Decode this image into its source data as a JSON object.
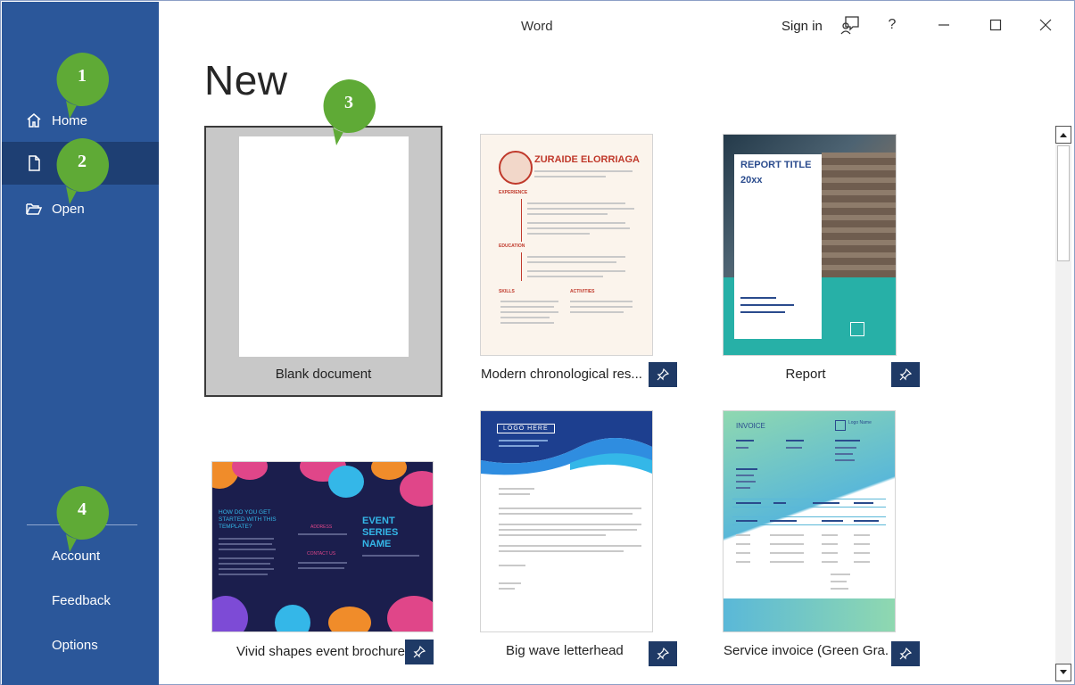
{
  "window": {
    "title": "Word"
  },
  "titlebar": {
    "sign_in": "Sign in",
    "help": "?"
  },
  "sidebar": {
    "items": [
      {
        "label": "Home",
        "icon": "home-icon"
      },
      {
        "label": "",
        "icon": "new-document-icon",
        "active": true
      },
      {
        "label": "Open",
        "icon": "folder-open-icon"
      }
    ],
    "bottom": {
      "account": "Account",
      "feedback": "Feedback",
      "options": "Options"
    }
  },
  "main": {
    "heading": "New",
    "templates": [
      {
        "label": "Blank document",
        "selected": true
      },
      {
        "label": "Modern chronological res...",
        "pinned": true
      },
      {
        "label": "Report",
        "pinned": true
      },
      {
        "label": "Vivid shapes event brochure",
        "pinned": true
      },
      {
        "label": "Big wave letterhead",
        "pinned": true
      },
      {
        "label": "Service invoice (Green Gra...",
        "pinned": true
      }
    ],
    "thumbs": {
      "resume": {
        "name": "ZURAIDE ELORRIAGA",
        "experience": "EXPERIENCE",
        "education": "EDUCATION",
        "skills": "SKILLS",
        "activities": "ACTIVITIES"
      },
      "report": {
        "title": "REPORT TITLE",
        "year": "20xx"
      },
      "brochure": {
        "q": "HOW DO YOU GET STARTED WITH THIS TEMPLATE?",
        "event": "EVENT SERIES NAME",
        "address": "ADDRESS",
        "contact": "CONTACT US"
      },
      "letterhead": {
        "logo": "LOGO HERE"
      },
      "invoice": {
        "title": "INVOICE",
        "logo": "Logo Name"
      }
    }
  },
  "callouts": [
    "1",
    "2",
    "3",
    "4"
  ],
  "colors": {
    "accent": "#2b579a",
    "accent_dark": "#1e3f73",
    "callout": "#5faa36",
    "pin": "#1f3a66"
  }
}
